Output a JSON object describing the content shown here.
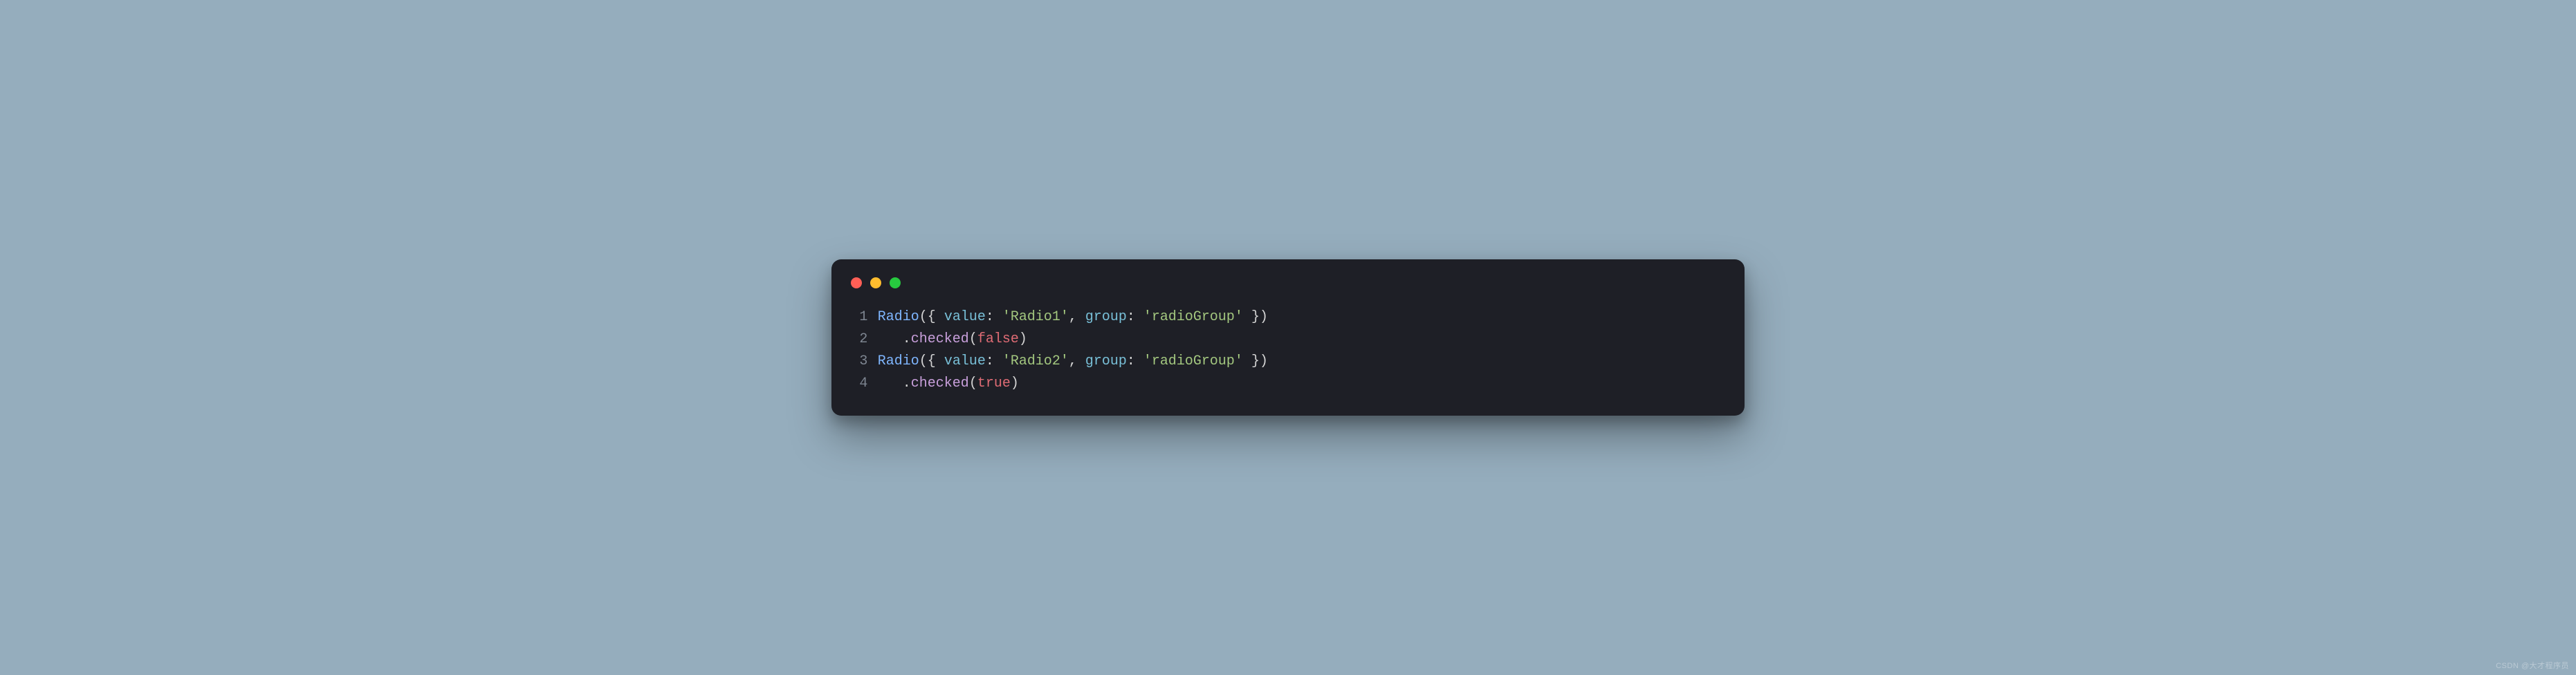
{
  "window": {
    "traffic_lights": [
      "red",
      "yellow",
      "green"
    ]
  },
  "code": {
    "lines": [
      {
        "n": "1",
        "tokens": [
          {
            "c": "fn",
            "t": "Radio"
          },
          {
            "c": "punc",
            "t": "({ "
          },
          {
            "c": "prop",
            "t": "value"
          },
          {
            "c": "punc",
            "t": ": "
          },
          {
            "c": "str",
            "t": "'Radio1'"
          },
          {
            "c": "punc",
            "t": ", "
          },
          {
            "c": "prop",
            "t": "group"
          },
          {
            "c": "punc",
            "t": ": "
          },
          {
            "c": "str",
            "t": "'radioGroup'"
          },
          {
            "c": "punc",
            "t": " })"
          }
        ]
      },
      {
        "n": "2",
        "tokens": [
          {
            "c": "punc",
            "t": "   ."
          },
          {
            "c": "meth",
            "t": "checked"
          },
          {
            "c": "punc",
            "t": "("
          },
          {
            "c": "kw",
            "t": "false"
          },
          {
            "c": "punc",
            "t": ")"
          }
        ]
      },
      {
        "n": "3",
        "tokens": [
          {
            "c": "fn",
            "t": "Radio"
          },
          {
            "c": "punc",
            "t": "({ "
          },
          {
            "c": "prop",
            "t": "value"
          },
          {
            "c": "punc",
            "t": ": "
          },
          {
            "c": "str",
            "t": "'Radio2'"
          },
          {
            "c": "punc",
            "t": ", "
          },
          {
            "c": "prop",
            "t": "group"
          },
          {
            "c": "punc",
            "t": ": "
          },
          {
            "c": "str",
            "t": "'radioGroup'"
          },
          {
            "c": "punc",
            "t": " })"
          }
        ]
      },
      {
        "n": "4",
        "tokens": [
          {
            "c": "punc",
            "t": "   ."
          },
          {
            "c": "meth",
            "t": "checked"
          },
          {
            "c": "punc",
            "t": "("
          },
          {
            "c": "kw",
            "t": "true"
          },
          {
            "c": "punc",
            "t": ")"
          }
        ]
      }
    ]
  },
  "watermark": "CSDN @大才程序员"
}
